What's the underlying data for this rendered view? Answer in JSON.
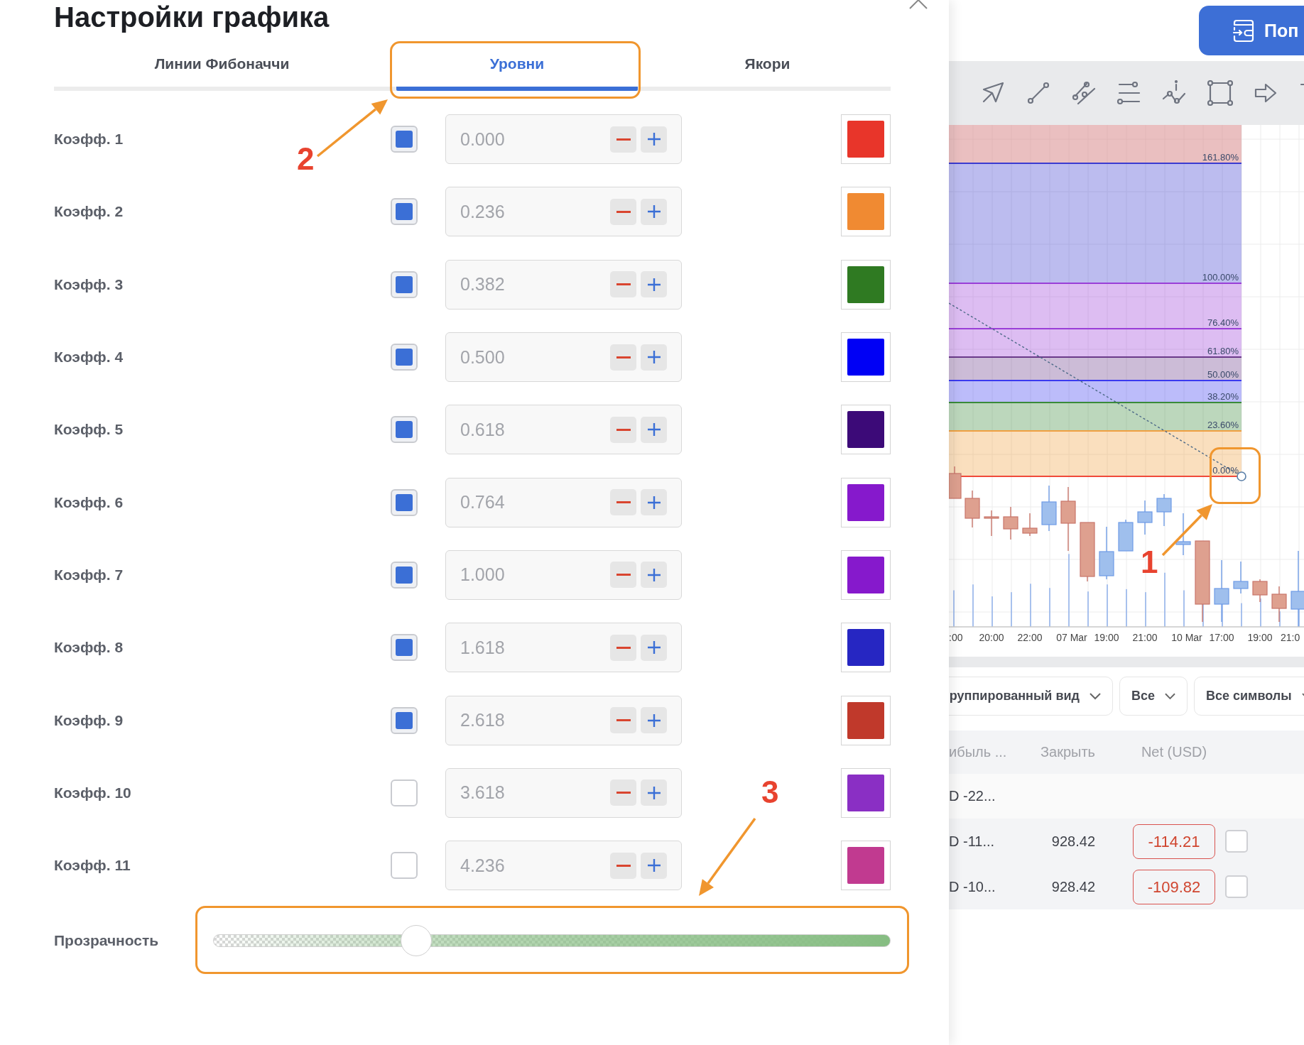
{
  "dialog": {
    "title": "Настройки графика",
    "tabs": [
      {
        "label": "Линии Фибоначчи",
        "selected": false
      },
      {
        "label": "Уровни",
        "selected": true
      },
      {
        "label": "Якори",
        "selected": false
      }
    ],
    "levels": [
      {
        "label": "Коэфф. 1",
        "enabled": true,
        "value": "0.000",
        "color": "#e8352a"
      },
      {
        "label": "Коэфф. 2",
        "enabled": true,
        "value": "0.236",
        "color": "#f08a32"
      },
      {
        "label": "Коэфф. 3",
        "enabled": true,
        "value": "0.382",
        "color": "#2f7a22"
      },
      {
        "label": "Коэфф. 4",
        "enabled": true,
        "value": "0.500",
        "color": "#0000f5"
      },
      {
        "label": "Коэфф. 5",
        "enabled": true,
        "value": "0.618",
        "color": "#3c0a78"
      },
      {
        "label": "Коэфф. 6",
        "enabled": true,
        "value": "0.764",
        "color": "#8619cc"
      },
      {
        "label": "Коэфф. 7",
        "enabled": true,
        "value": "1.000",
        "color": "#8619cc"
      },
      {
        "label": "Коэфф. 8",
        "enabled": true,
        "value": "1.618",
        "color": "#2626c2"
      },
      {
        "label": "Коэфф. 9",
        "enabled": true,
        "value": "2.618",
        "color": "#c0392b"
      },
      {
        "label": "Коэфф. 10",
        "enabled": false,
        "value": "3.618",
        "color": "#8a2fc4"
      },
      {
        "label": "Коэфф. 11",
        "enabled": false,
        "value": "4.236",
        "color": "#c13a90"
      }
    ],
    "opacity": {
      "label": "Прозрачность",
      "level": 0.3
    }
  },
  "right_panel": {
    "top_button": {
      "label": "Поп"
    },
    "chart": {
      "levels": [
        {
          "label": "161.80%",
          "color": "#3b3bd0"
        },
        {
          "label": "100.00%",
          "color": "#9a3fd8"
        },
        {
          "label": "76.40%",
          "color": "#9a3fd8"
        },
        {
          "label": "61.80%",
          "color": "#6a3a8a"
        },
        {
          "label": "50.00%",
          "color": "#3a3af0"
        },
        {
          "label": "38.20%",
          "color": "#3a8a3a"
        },
        {
          "label": "23.60%",
          "color": "#f0a040"
        },
        {
          "label": "0.00%",
          "color": "#f04a3a"
        }
      ],
      "time_labels": [
        ":00",
        "20:00",
        "22:00",
        "07 Mar",
        "19:00",
        "21:00",
        "10 Mar",
        "17:00",
        "19:00",
        "21:0"
      ]
    },
    "filters": [
      {
        "label": "руппированный вид"
      },
      {
        "label": "Все"
      },
      {
        "label": "Все символы"
      }
    ],
    "table": {
      "columns": [
        "ибыль ...",
        "Закрыть",
        "Net (USD)"
      ],
      "rows": [
        {
          "kind": "group",
          "cells": [
            "D -22..."
          ]
        },
        {
          "kind": "trade",
          "cells": [
            "D -11...",
            "928.42"
          ],
          "net": "-114.21",
          "checked": false
        },
        {
          "kind": "trade",
          "cells": [
            "D -10...",
            "928.42"
          ],
          "net": "-109.82",
          "checked": false
        }
      ]
    }
  },
  "annotations": [
    {
      "number": "2"
    },
    {
      "number": "1"
    },
    {
      "number": "3"
    }
  ]
}
